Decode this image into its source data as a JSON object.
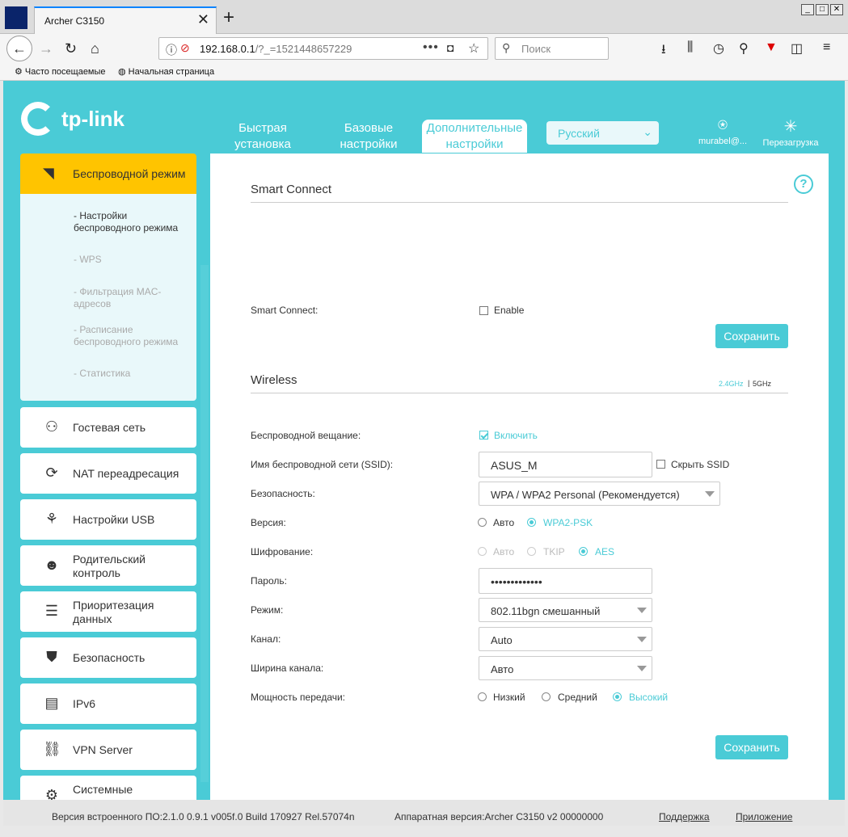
{
  "browser": {
    "tab_title": "Archer C3150",
    "tab_close": "✕",
    "new_tab": "+",
    "url_host": "192.168.0.1",
    "url_path": "/?_=1521448657229",
    "search_placeholder": "Поиск",
    "bookmarks": [
      "Часто посещаемые",
      "Начальная страница"
    ]
  },
  "header": {
    "logo": "tp-link",
    "nav": [
      "Быстрая установка",
      "Базовые настройки",
      "Дополнительные настройки"
    ],
    "language": "Русский",
    "user": "murabel@...",
    "reboot": "Перезагрузка"
  },
  "sidebar": {
    "active": "Беспроводной режим",
    "submenu": [
      "- Настройки беспроводного режима",
      "- WPS",
      "- Фильтрация MAC-адресов",
      "- Расписание беспроводного режима",
      "- Статистика"
    ],
    "items": [
      "Гостевая сеть",
      "NAT переадресация",
      "Настройки USB",
      "Родительский контроль",
      "Приоритезация данных",
      "Безопасность",
      "IPv6",
      "VPN Server",
      "Системные"
    ]
  },
  "smart_connect": {
    "title": "Smart Connect",
    "label": "Smart Connect:",
    "enable": "Enable",
    "save": "Сохранить"
  },
  "wireless": {
    "title": "Wireless",
    "band_24": "2.4GHz",
    "band_5": "5GHz",
    "labels": {
      "broadcast": "Беспроводной вещание:",
      "ssid": "Имя беспроводной сети (SSID):",
      "security": "Безопасность:",
      "version": "Версия:",
      "encryption": "Шифрование:",
      "password": "Пароль:",
      "mode": "Режим:",
      "channel": "Канал:",
      "width": "Ширина канала:",
      "power": "Мощность передачи:"
    },
    "broadcast_on": "Включить",
    "ssid_value": "ASUS_M",
    "hide_ssid": "Скрыть SSID",
    "security_value": "WPA / WPA2 Personal (Рекомендуется)",
    "version_options": [
      "Авто",
      "WPA2-PSK"
    ],
    "encryption_options": [
      "Авто",
      "TKIP",
      "AES"
    ],
    "password_value": "•••••••••••••",
    "mode_value": "802.11bgn смешанный",
    "channel_value": "Auto",
    "width_value": "Авто",
    "power_options": [
      "Низкий",
      "Средний",
      "Высокий"
    ],
    "save": "Сохранить"
  },
  "footer": {
    "firmware": "Версия встроенного ПО:2.1.0 0.9.1 v005f.0 Build 170927 Rel.57074n",
    "hardware": "Аппаратная версия:Archer C3150 v2 00000000",
    "support": "Поддержка",
    "app": "Приложение"
  }
}
